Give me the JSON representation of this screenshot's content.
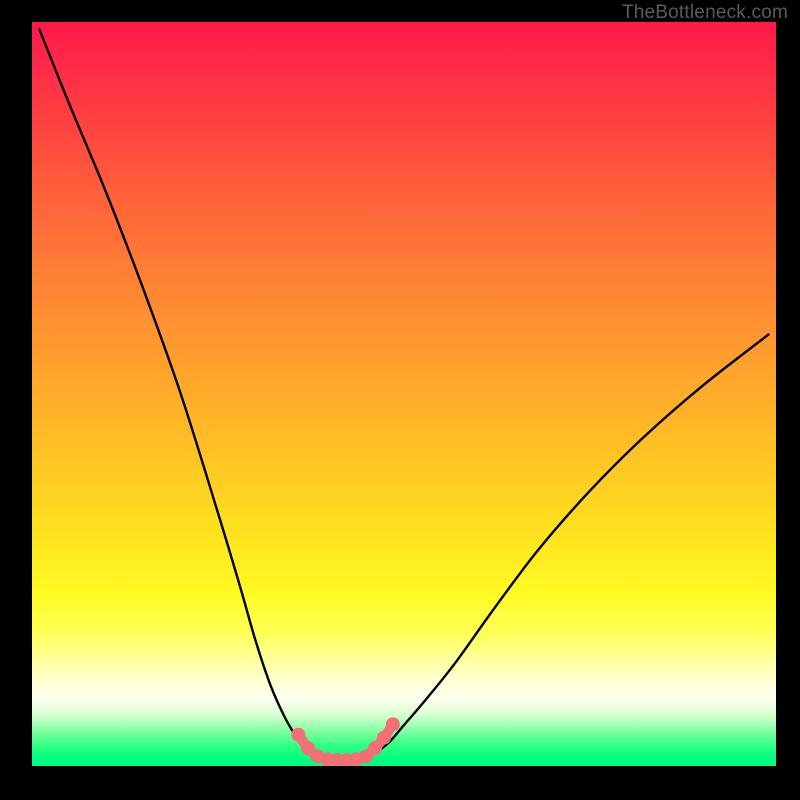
{
  "watermark": "TheBottleneck.com",
  "chart_data": {
    "type": "line",
    "title": "",
    "xlabel": "",
    "ylabel": "",
    "xlim": [
      0,
      100
    ],
    "ylim": [
      0,
      100
    ],
    "grid": false,
    "legend": false,
    "series": [
      {
        "name": "left-curve",
        "x": [
          1,
          5,
          10,
          15,
          20,
          25,
          28,
          30,
          32,
          34,
          35.5,
          37,
          38
        ],
        "y": [
          99,
          89,
          77,
          64,
          50,
          34,
          24,
          17,
          11,
          6.5,
          4,
          2.2,
          1.4
        ]
      },
      {
        "name": "right-curve",
        "x": [
          46,
          48,
          50,
          53,
          57,
          62,
          68,
          75,
          82,
          90,
          99
        ],
        "y": [
          1.6,
          3.2,
          5.5,
          9,
          14,
          21,
          29,
          37,
          44,
          51,
          58
        ]
      },
      {
        "name": "pink-segment",
        "x": [
          35.8,
          37.1,
          38.4,
          39.7,
          41.0,
          42.3,
          43.6,
          44.9,
          46.1,
          47.3,
          48.5
        ],
        "y": [
          4.2,
          2.4,
          1.3,
          0.9,
          0.8,
          0.8,
          0.9,
          1.3,
          2.4,
          3.8,
          5.6
        ]
      }
    ],
    "gradient_stops": [
      {
        "pos": 0.0,
        "color": "#ff1a4a"
      },
      {
        "pos": 0.5,
        "color": "#ffb128"
      },
      {
        "pos": 0.8,
        "color": "#ffff55"
      },
      {
        "pos": 0.92,
        "color": "#d9ffd2"
      },
      {
        "pos": 1.0,
        "color": "#00ff7e"
      }
    ],
    "pink_color": "#f36f76",
    "curve_color": "#000000"
  }
}
